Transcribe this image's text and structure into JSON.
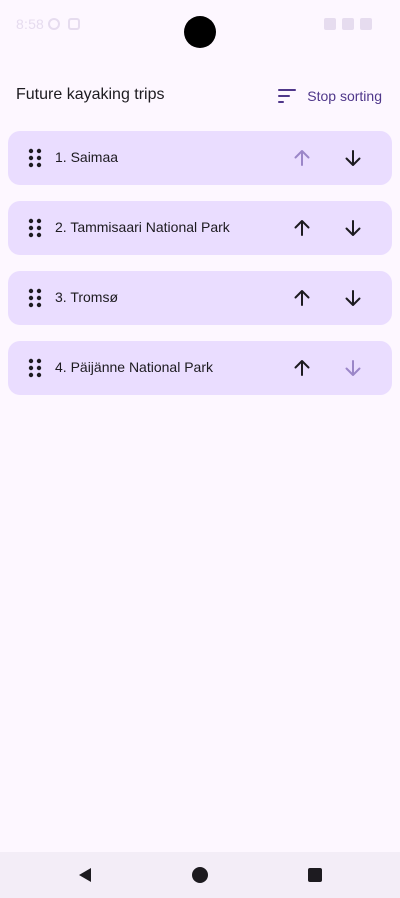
{
  "status_bar": {
    "time": "8:58"
  },
  "header": {
    "title": "Future kayaking trips",
    "sort_button_label": "Stop sorting"
  },
  "trips": [
    {
      "label": "1. Saimaa",
      "can_move_up": false,
      "can_move_down": true
    },
    {
      "label": "2. Tammisaari National Park",
      "can_move_up": true,
      "can_move_down": true
    },
    {
      "label": "3. Tromsø",
      "can_move_up": true,
      "can_move_down": true
    },
    {
      "label": "4. Päijänne National Park",
      "can_move_up": true,
      "can_move_down": false
    }
  ],
  "icons": {
    "sort": "sort-icon",
    "drag_handle": "drag-indicator-icon",
    "move_up": "arrow-up-icon",
    "move_down": "arrow-down-icon",
    "nav_back": "triangle-back-icon",
    "nav_home": "circle-home-icon",
    "nav_recents": "square-recents-icon"
  },
  "colors": {
    "background": "#fdf7ff",
    "card": "#eaddff",
    "accent": "#4f378a",
    "disabled_icon": "#9b86c8"
  }
}
